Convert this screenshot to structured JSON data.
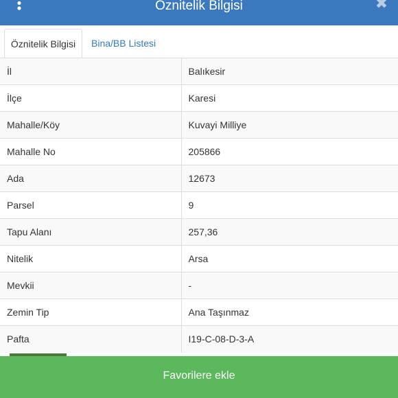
{
  "header": {
    "title": "Öznitelik Bilgisi",
    "menu_icon": "vertical-dots-icon",
    "close_icon": "close-icon",
    "close_glyph": "✖",
    "color": "#3b79bf"
  },
  "tabs": [
    {
      "label": "Öznitelik Bilgisi",
      "active": true
    },
    {
      "label": "Bina/BB Listesi",
      "active": false
    }
  ],
  "rows": [
    {
      "key": "İl",
      "value": "Balıkesir"
    },
    {
      "key": "İlçe",
      "value": "Karesi"
    },
    {
      "key": "Mahalle/Köy",
      "value": "Kuvayi Milliye"
    },
    {
      "key": "Mahalle No",
      "value": "205866"
    },
    {
      "key": "Ada",
      "value": "12673"
    },
    {
      "key": "Parsel",
      "value": "9"
    },
    {
      "key": "Tapu Alanı",
      "value": "257,36"
    },
    {
      "key": "Nitelik",
      "value": "Arsa"
    },
    {
      "key": "Mevkii",
      "value": "-"
    },
    {
      "key": "Zemin Tip",
      "value": "Ana Taşınmaz"
    },
    {
      "key": "Pafta",
      "value": "I19-C-08-D-3-A"
    }
  ],
  "footer": {
    "button_label": "Favorilere ekle",
    "color": "#5cb85c"
  },
  "badge_icon": "logo-badge-icon"
}
